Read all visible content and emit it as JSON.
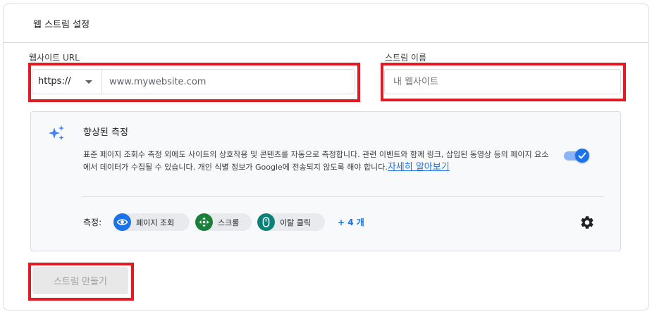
{
  "panel": {
    "title": "웹 스트림 설정"
  },
  "website_url": {
    "label": "웹사이트 URL",
    "protocol": "https://",
    "placeholder": "www.mywebsite.com"
  },
  "stream_name": {
    "label": "스트림 이름",
    "placeholder": "내 웹사이트"
  },
  "enhanced_measurement": {
    "title": "향상된 측정",
    "description": "표준 페이지 조회수 측정 외에도 사이트의 상호작용 및 콘텐츠를 자동으로 측정합니다. 관련 이벤트와 함께 링크, 삽입된 동영상 등의 페이지 요소에서 데이터가 수집될 수 있습니다. 개인 식별 정보가 Google에 전송되지 않도록 해야 합니다.",
    "learn_more": "자세히 알아보기",
    "enabled": true,
    "measure_label": "측정:",
    "chips": [
      {
        "label": "페이지 조회",
        "icon": "eye-icon"
      },
      {
        "label": "스크롤",
        "icon": "scroll-arrows-icon"
      },
      {
        "label": "이탈 클릭",
        "icon": "mouse-icon"
      }
    ],
    "more": "+ 4 개"
  },
  "create_button": {
    "label": "스트림 만들기"
  },
  "colors": {
    "accent": "#1a73e8",
    "highlight_box": "#e01b24",
    "chip_scroll": "#188038",
    "chip_outbound": "#0b8078"
  }
}
